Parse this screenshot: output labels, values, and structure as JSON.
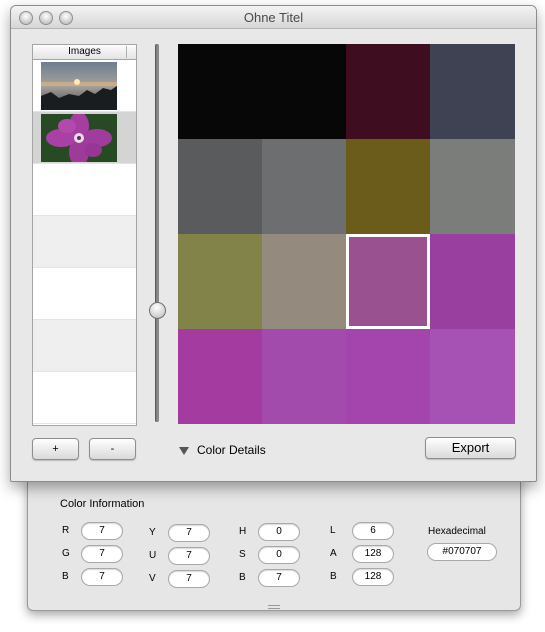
{
  "window": {
    "title": "Ohne Titel"
  },
  "images_table": {
    "header": "Images",
    "thumbnails": [
      "sunset-photo",
      "purple-flower-photo"
    ],
    "selected_index": 1
  },
  "slider": {
    "level": 0.7
  },
  "color_grid": {
    "rows": 4,
    "cols": 4,
    "selected_index": 10,
    "colors": [
      "#070707",
      "#070707",
      "#3e0d1f",
      "#3e4253",
      "#5a5b5c",
      "#6d6e6f",
      "#6b5c1c",
      "#7b7d7b",
      "#818349",
      "#948a7e",
      "#99528f",
      "#993f9f",
      "#a43ba1",
      "#a24bac",
      "#a445ae",
      "#a652b4"
    ]
  },
  "controls": {
    "add_label": "+",
    "remove_label": "-",
    "details_label": "Color Details",
    "export_label": "Export"
  },
  "color_info": {
    "title": "Color Information",
    "rgb": [
      {
        "label": "R",
        "value": "7"
      },
      {
        "label": "G",
        "value": "7"
      },
      {
        "label": "B",
        "value": "7"
      }
    ],
    "yuv": [
      {
        "label": "Y",
        "value": "7"
      },
      {
        "label": "U",
        "value": "7"
      },
      {
        "label": "V",
        "value": "7"
      }
    ],
    "hsb": [
      {
        "label": "H",
        "value": "0"
      },
      {
        "label": "S",
        "value": "0"
      },
      {
        "label": "B",
        "value": "7"
      }
    ],
    "lab": [
      {
        "label": "L",
        "value": "6"
      },
      {
        "label": "A",
        "value": "128"
      },
      {
        "label": "B",
        "value": "128"
      }
    ],
    "hex_label": "Hexadecimal",
    "hex_value": "#070707"
  }
}
